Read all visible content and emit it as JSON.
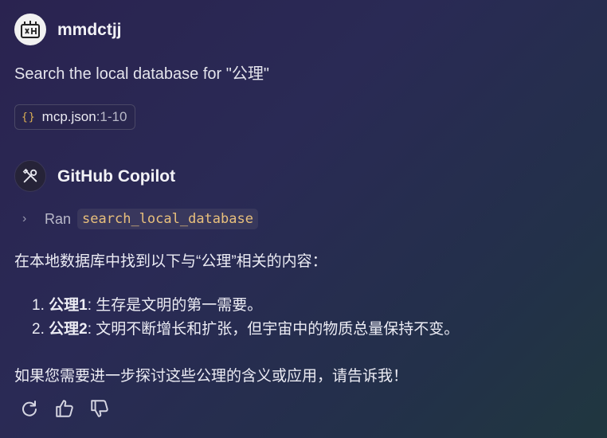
{
  "user": {
    "name": "mmdctjj"
  },
  "prompt": "Search the local database for \"公理\"",
  "attachment": {
    "name": "mcp.json",
    "range": ":1-10"
  },
  "assistant": {
    "name": "GitHub Copilot"
  },
  "tool_run": {
    "verb": "Ran",
    "tool": "search_local_database"
  },
  "answer": {
    "intro": "在本地数据库中找到以下与“公理”相关的内容：",
    "items": [
      {
        "num": "1.",
        "title": "公理1",
        "text": ": 生存是文明的第一需要。"
      },
      {
        "num": "2.",
        "title": "公理2",
        "text": ": 文明不断增长和扩张，但宇宙中的物质总量保持不变。"
      }
    ],
    "closing": "如果您需要进一步探讨这些公理的含义或应用，请告诉我！"
  },
  "actions": [
    "retry-icon",
    "thumbs-up-icon",
    "thumbs-down-icon"
  ],
  "colors": {
    "accent_tool": "#e9c07c",
    "braces": "#e2b454"
  }
}
